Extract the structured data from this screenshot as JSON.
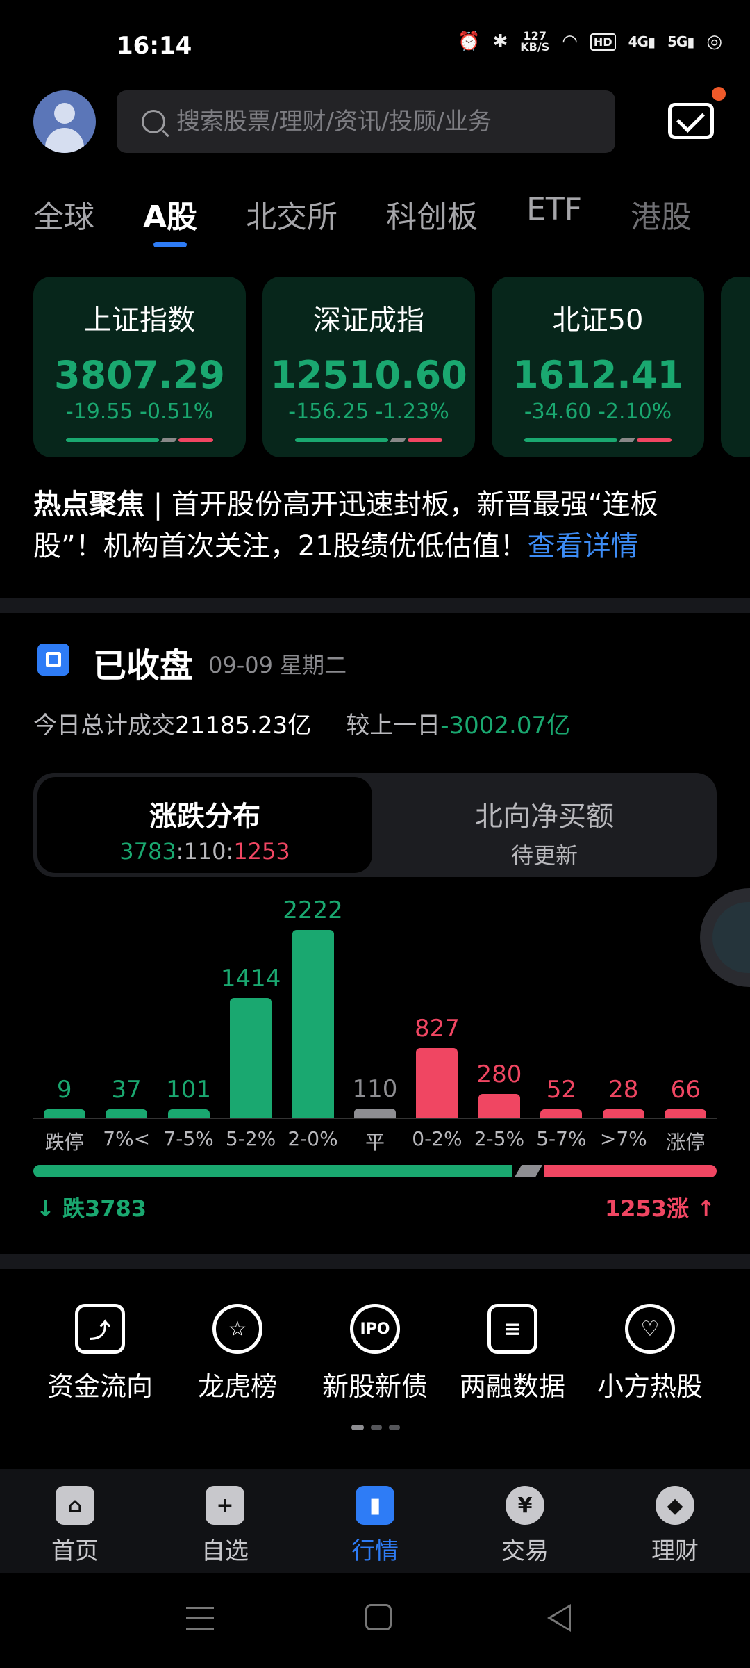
{
  "status": {
    "time": "16:14",
    "net_speed_top": "127",
    "net_speed_unit": "KB/S",
    "hd_badge": "HD",
    "sig1": "4G",
    "sig2": "5G"
  },
  "search": {
    "placeholder": "搜索股票/理财/资讯/投顾/业务"
  },
  "tabs": [
    "全球",
    "A股",
    "北交所",
    "科创板",
    "ETF",
    "港股"
  ],
  "indices": [
    {
      "name": "上证指数",
      "value": "3807.29",
      "change": "-19.55 -0.51%"
    },
    {
      "name": "深证成指",
      "value": "12510.60",
      "change": "-156.25 -1.23%"
    },
    {
      "name": "北证50",
      "value": "1612.41",
      "change": "-34.60 -2.10%"
    }
  ],
  "news": {
    "tag": "热点聚焦",
    "sep": " | ",
    "text": "首开股份高开迅速封板，新晋最强“连板股”！机构首次关注，21股绩优低估值！",
    "link": "查看详情"
  },
  "market": {
    "title": "已收盘",
    "date": "09-09 星期二",
    "turnover_label": "今日总计成交",
    "turnover_value": "21185.23亿",
    "compare_label": "较上一日",
    "compare_value": "-3002.07亿"
  },
  "switch": {
    "left_title": "涨跌分布",
    "fall": "3783",
    "flat": "110",
    "rise": "1253",
    "colon": ":",
    "right_title": "北向净买额",
    "right_sub": "待更新"
  },
  "chart_data": {
    "type": "bar",
    "categories": [
      "跌停",
      "7%<",
      "7-5%",
      "5-2%",
      "2-0%",
      "平",
      "0-2%",
      "2-5%",
      "5-7%",
      ">7%",
      "涨停"
    ],
    "values": [
      9,
      37,
      101,
      1414,
      2222,
      110,
      827,
      280,
      52,
      28,
      66
    ],
    "colors": [
      "#1aa870",
      "#1aa870",
      "#1aa870",
      "#1aa870",
      "#1aa870",
      "#8e8e92",
      "#f04662",
      "#f04662",
      "#f04662",
      "#f04662",
      "#f04662"
    ]
  },
  "distribution": {
    "fall_label": "跌3783",
    "rise_label": "1253涨",
    "fall": 3783,
    "flat": 110,
    "rise": 1253
  },
  "shortcuts": [
    {
      "label": "资金流向",
      "icon": "fund-flow-icon",
      "glyph": "⤴"
    },
    {
      "label": "龙虎榜",
      "icon": "ranking-medal-icon",
      "glyph": "☆"
    },
    {
      "label": "新股新债",
      "icon": "ipo-icon",
      "glyph": "IPO"
    },
    {
      "label": "两融数据",
      "icon": "margin-data-icon",
      "glyph": "≡"
    },
    {
      "label": "小方热股",
      "icon": "hot-stock-heart-icon",
      "glyph": "♡"
    }
  ],
  "nav": [
    {
      "label": "首页",
      "icon": "home-icon",
      "glyph": "⌂"
    },
    {
      "label": "自选",
      "icon": "add-watchlist-icon",
      "glyph": "+"
    },
    {
      "label": "行情",
      "icon": "market-chart-icon",
      "glyph": "▮"
    },
    {
      "label": "交易",
      "icon": "trade-yen-icon",
      "glyph": "¥"
    },
    {
      "label": "理财",
      "icon": "wealth-diamond-icon",
      "glyph": "◆"
    }
  ],
  "colors": {
    "accent": "#2e7cf6",
    "fall": "#1aa870",
    "rise": "#f04662",
    "flat": "#8e8e92"
  }
}
